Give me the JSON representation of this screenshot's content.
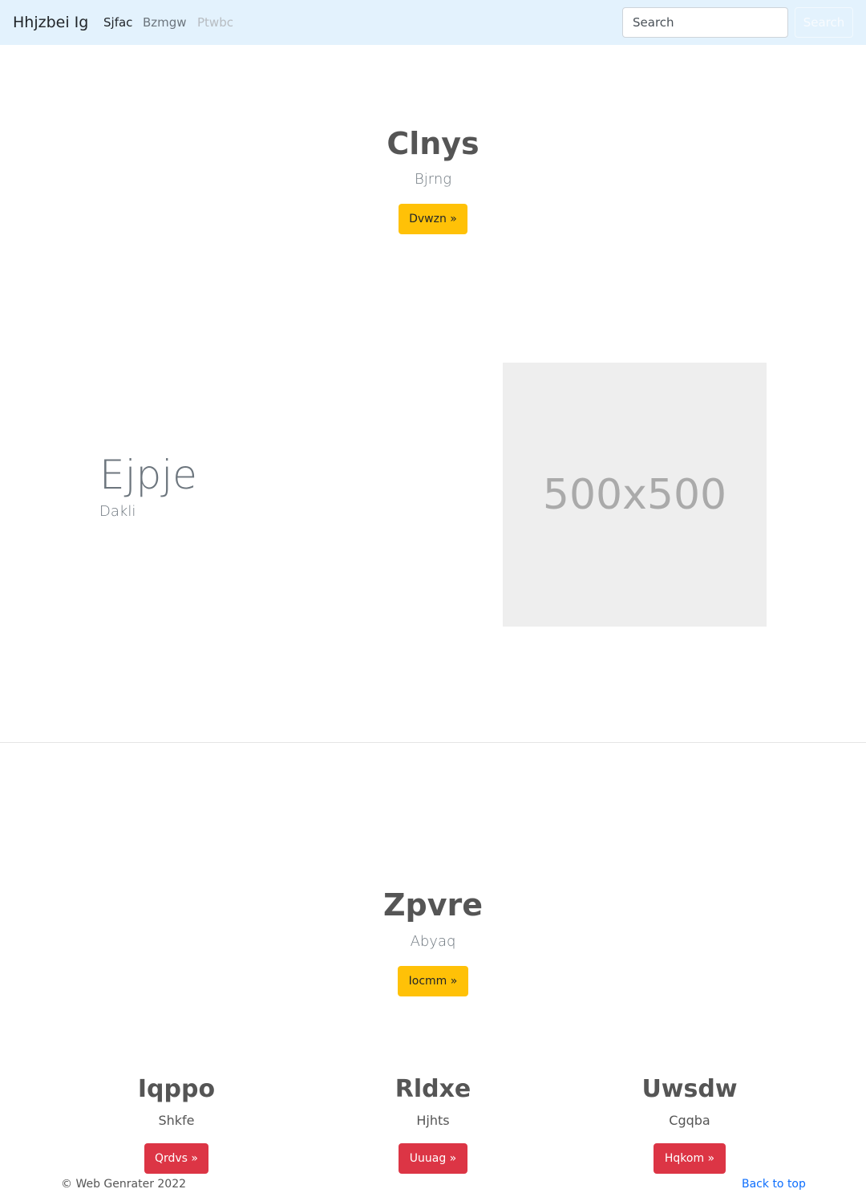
{
  "navbar": {
    "brand": "Hhjzbei Ig",
    "links": [
      {
        "label": "Sjfac",
        "state": "active"
      },
      {
        "label": "Bzmgw",
        "state": "normal"
      },
      {
        "label": "Ptwbc",
        "state": "disabled"
      }
    ],
    "search_placeholder": "Search",
    "search_button": "Search"
  },
  "hero": {
    "title": "Clnys",
    "subtitle": "Bjrng",
    "button": "Dvwzn »"
  },
  "feature": {
    "title": "Ejpje",
    "subtitle": "Dakli",
    "image_label": "500x500"
  },
  "section2": {
    "title": "Zpvre",
    "subtitle": "Abyaq",
    "button": "Iocmm »"
  },
  "columns": [
    {
      "title": "Iqppo",
      "subtitle": "Shkfe",
      "button": "Qrdvs »"
    },
    {
      "title": "Rldxe",
      "subtitle": "Hjhts",
      "button": "Uuuag »"
    },
    {
      "title": "Uwsdw",
      "subtitle": "Cgqba",
      "button": "Hqkom »"
    }
  ],
  "footer": {
    "copyright": "© Web Genrater 2022",
    "back_to_top": "Back to top"
  },
  "colors": {
    "navbar_bg": "#e3f2fd",
    "warning": "#ffc107",
    "danger": "#dc3545",
    "link": "#0d6efd"
  }
}
